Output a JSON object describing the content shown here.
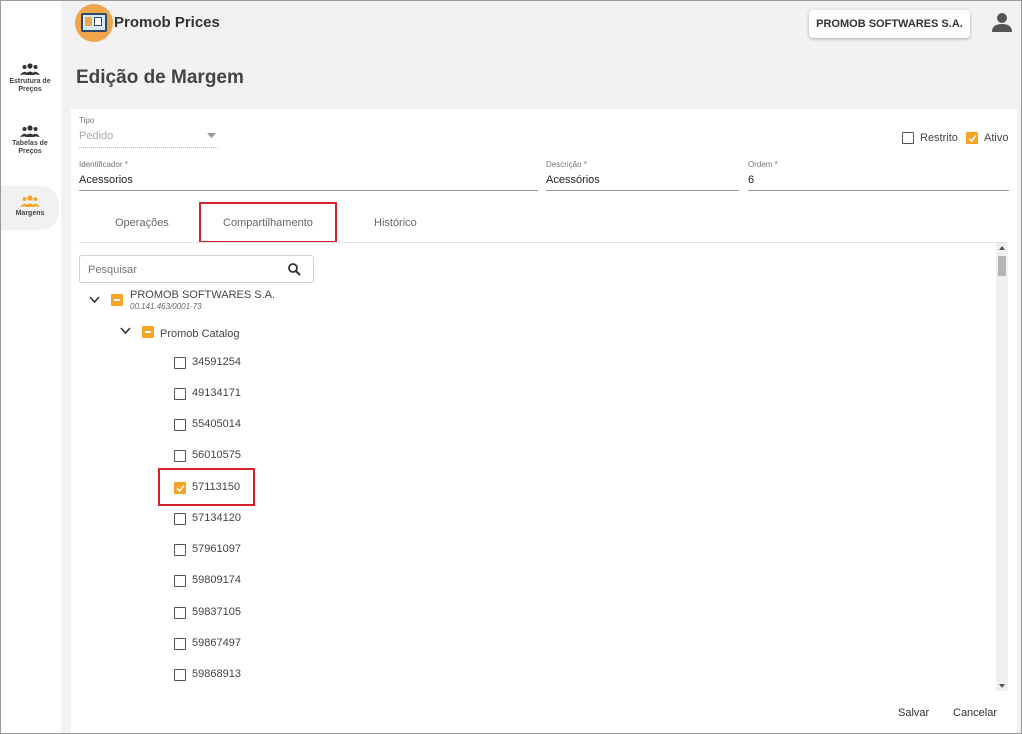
{
  "header": {
    "app_title": "Promob Prices",
    "company": "PROMOB SOFTWARES S.A."
  },
  "sidebar": {
    "items": [
      {
        "label_line1": "Estrutura de",
        "label_line2": "Preços"
      },
      {
        "label_line1": "Tabelas de",
        "label_line2": "Preços"
      },
      {
        "label_line1": "Margens",
        "label_line2": ""
      }
    ]
  },
  "page": {
    "title": "Edição de Margem"
  },
  "form": {
    "tipo": {
      "label": "Tipo",
      "value": "Pedido"
    },
    "restrito": {
      "label": "Restrito",
      "checked": false
    },
    "ativo": {
      "label": "Ativo",
      "checked": true
    },
    "identificador": {
      "label": "Identificador *",
      "value": "Acessorios"
    },
    "descricao": {
      "label": "Descrição *",
      "value": "Acessórios"
    },
    "ordem": {
      "label": "Ordem *",
      "value": "6"
    }
  },
  "tabs": [
    {
      "label": "Operações"
    },
    {
      "label": "Compartilhamento"
    },
    {
      "label": "Histórico"
    }
  ],
  "search": {
    "placeholder": "Pesquisar"
  },
  "tree": {
    "root": {
      "label": "PROMOB SOFTWARES S.A.",
      "sub": "00.141.463/0001-73"
    },
    "child": {
      "label": "Promob Catalog"
    },
    "items": [
      {
        "label": "34591254",
        "checked": false
      },
      {
        "label": "49134171",
        "checked": false
      },
      {
        "label": "55405014",
        "checked": false
      },
      {
        "label": "56010575",
        "checked": false
      },
      {
        "label": "57113150",
        "checked": true
      },
      {
        "label": "57134120",
        "checked": false
      },
      {
        "label": "57961097",
        "checked": false
      },
      {
        "label": "59809174",
        "checked": false
      },
      {
        "label": "59837105",
        "checked": false
      },
      {
        "label": "59867497",
        "checked": false
      },
      {
        "label": "59868913",
        "checked": false
      }
    ]
  },
  "footer": {
    "save": "Salvar",
    "cancel": "Cancelar"
  },
  "colors": {
    "accent": "#f5a428",
    "highlight": "#d6202c"
  }
}
